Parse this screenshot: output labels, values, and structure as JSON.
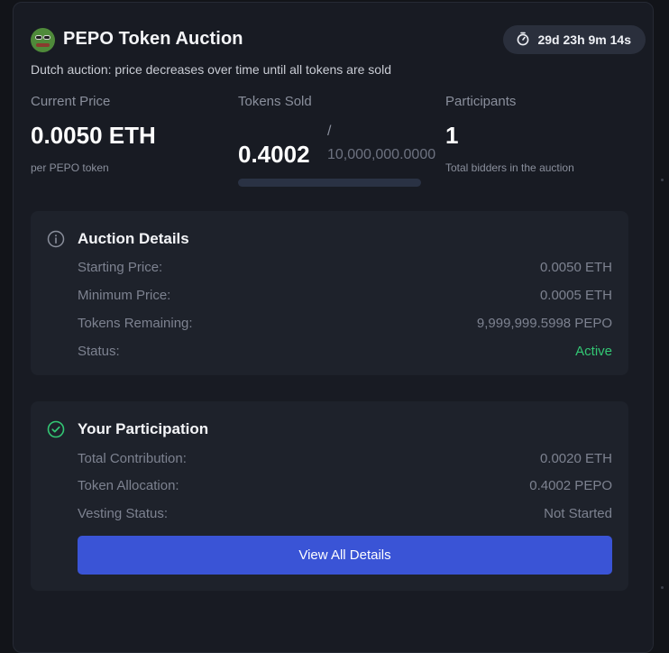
{
  "header": {
    "title": "PEPO Token Auction",
    "timer": "29d 23h 9m 14s",
    "subtitle": "Dutch auction: price decreases over time until all tokens are sold",
    "logo_icon": "pepe-frog-avatar",
    "timer_icon": "stopwatch-icon"
  },
  "stats": {
    "current_price": {
      "label": "Current Price",
      "value": "0.0050 ETH",
      "note": "per PEPO token"
    },
    "tokens_sold": {
      "label": "Tokens Sold",
      "value": "0.4002",
      "separator": "/",
      "total": "10,000,000.0000",
      "progress_fraction": 4e-08
    },
    "participants": {
      "label": "Participants",
      "value": "1",
      "note": "Total bidders in the auction"
    }
  },
  "auction_details": {
    "title": "Auction Details",
    "icon": "info-icon",
    "rows": [
      {
        "label": "Starting Price:",
        "value": "0.0050 ETH"
      },
      {
        "label": "Minimum Price:",
        "value": "0.0005 ETH"
      },
      {
        "label": "Tokens Remaining:",
        "value": "9,999,999.5998 PEPO"
      },
      {
        "label": "Status:",
        "value": "Active"
      }
    ]
  },
  "participation": {
    "title": "Your Participation",
    "icon": "check-circle-icon",
    "rows": [
      {
        "label": "Total Contribution:",
        "value": "0.0020 ETH"
      },
      {
        "label": "Token Allocation:",
        "value": "0.4002 PEPO"
      },
      {
        "label": "Vesting Status:",
        "value": "Not Started"
      }
    ],
    "button_label": "View All Details"
  },
  "colors": {
    "background": "#121419",
    "card": "#181b23",
    "panel": "#1e222b",
    "accent": "#3a54d6",
    "active_status": "#33c774"
  }
}
